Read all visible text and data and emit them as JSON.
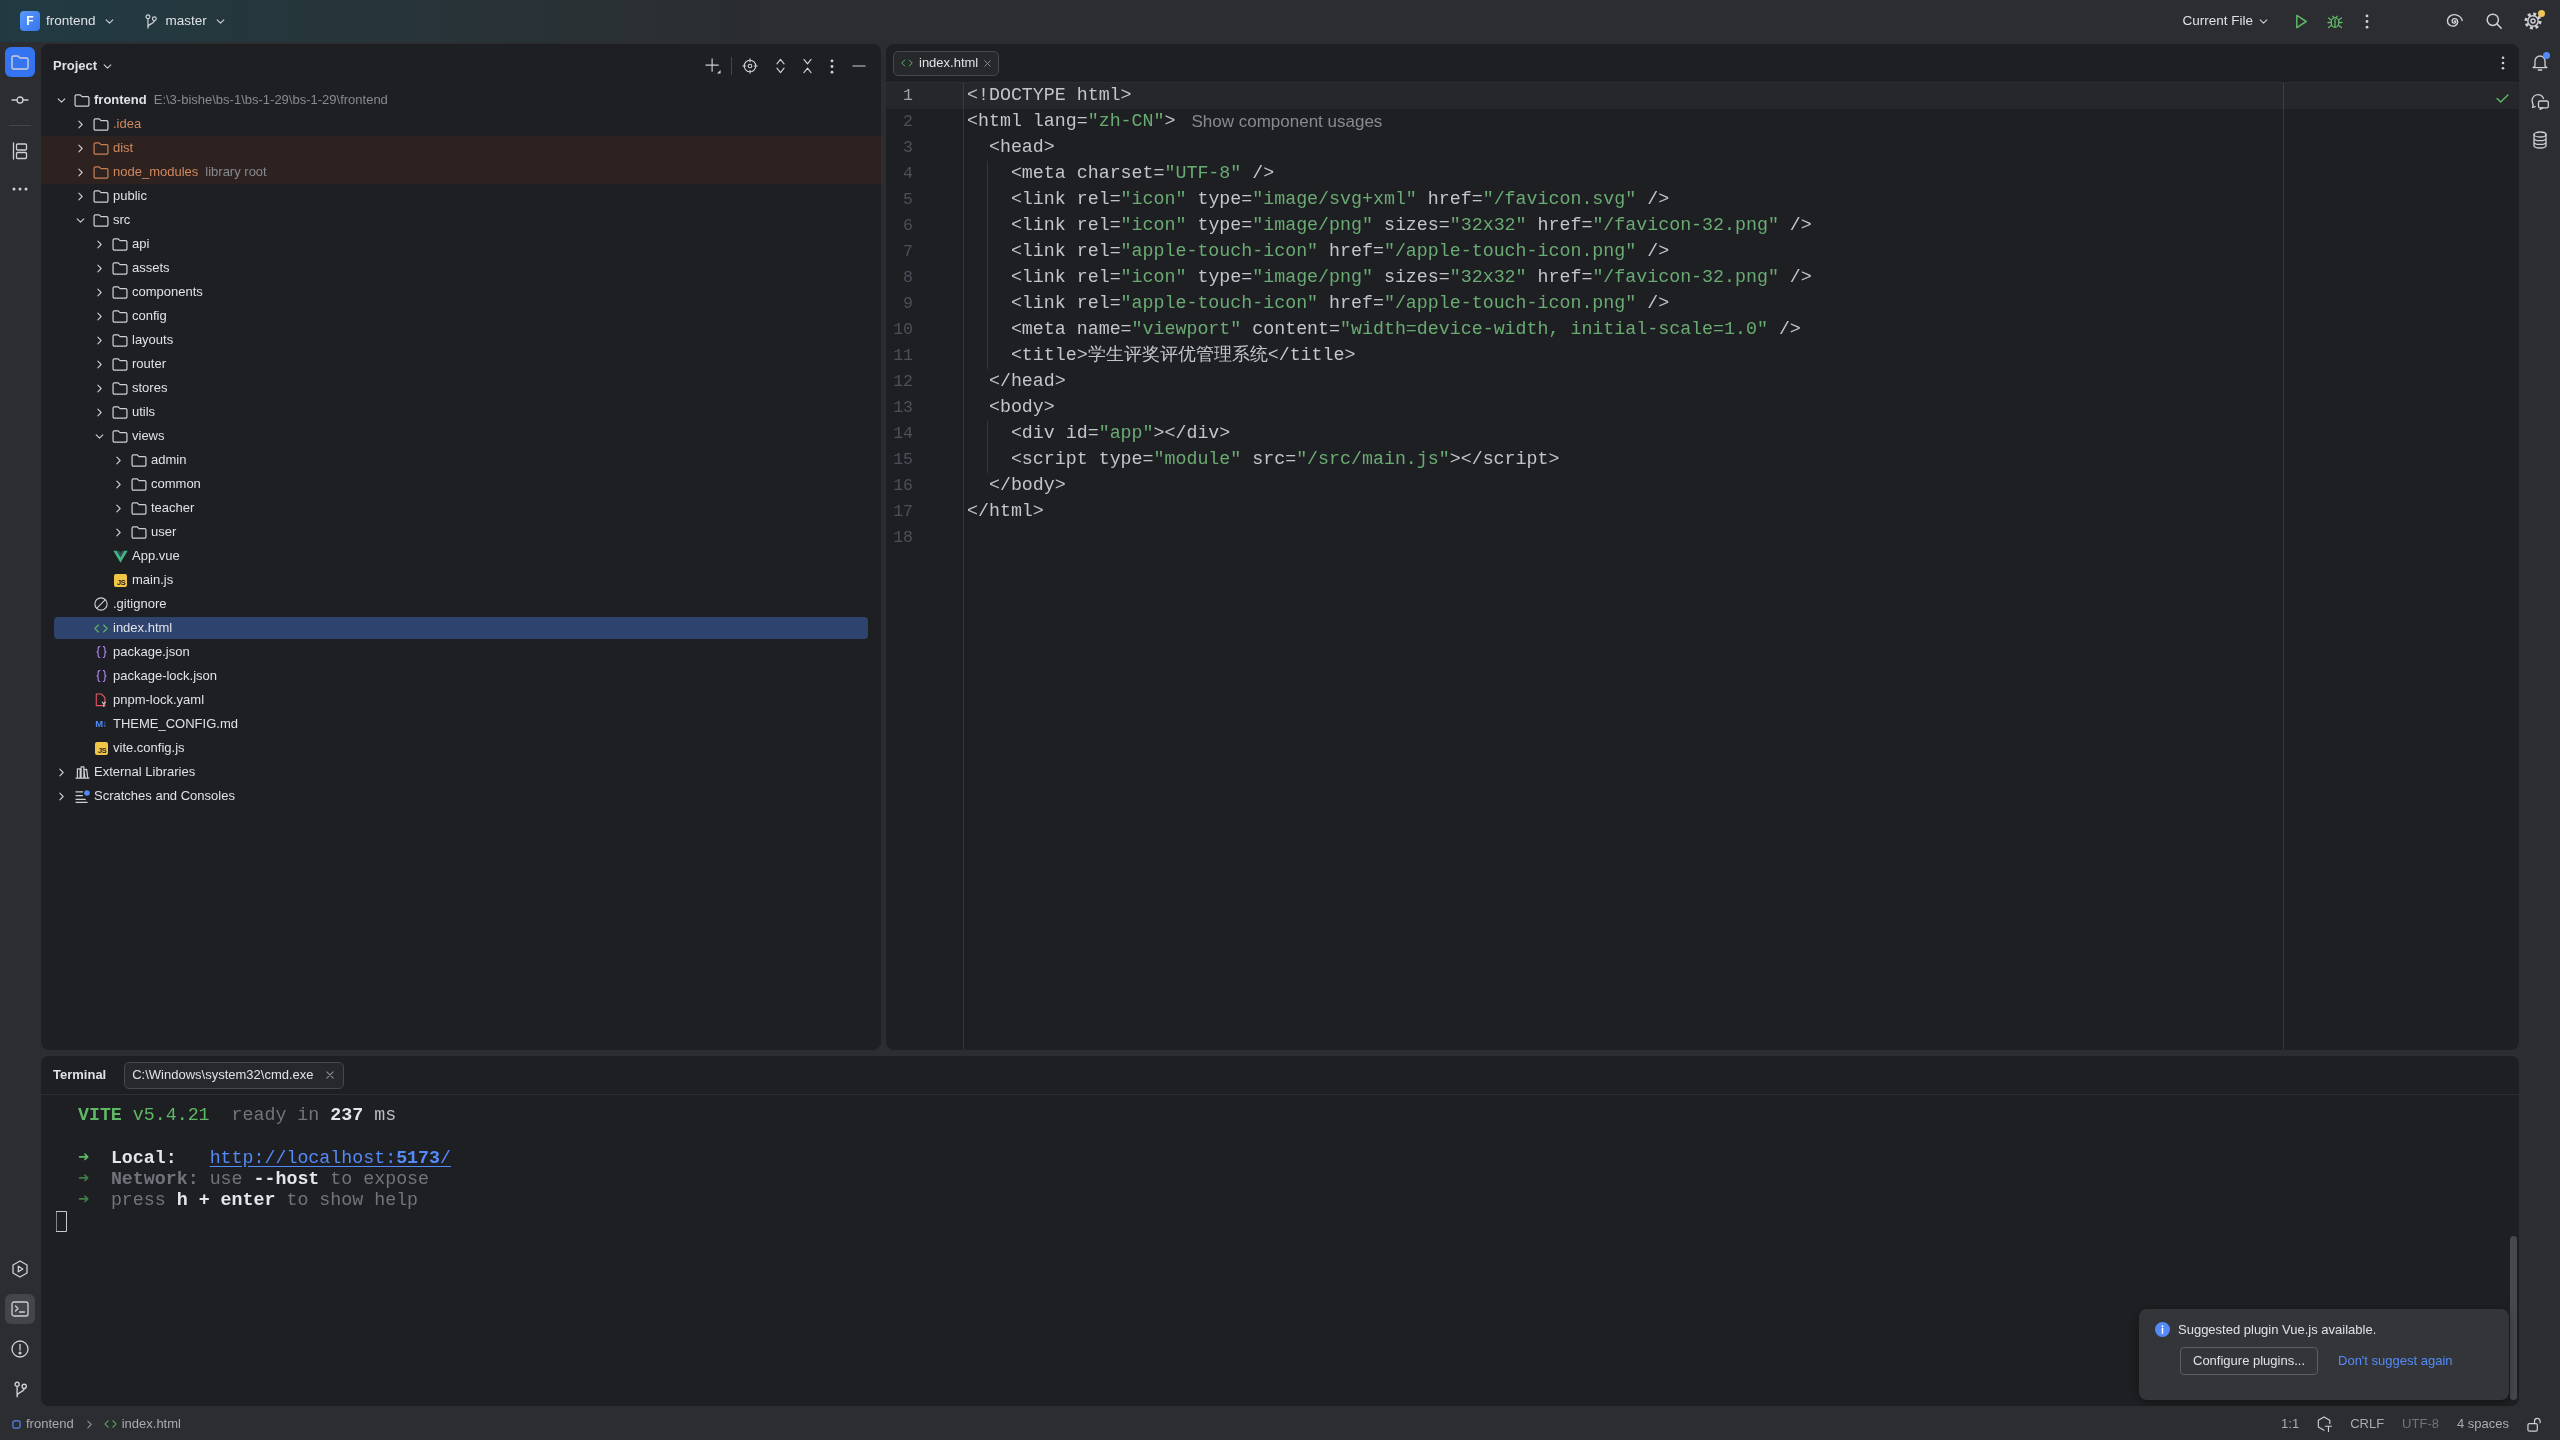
{
  "title_bar": {
    "project": {
      "initial": "F",
      "name": "frontend"
    },
    "branch": "master",
    "run_configuration": "Current File",
    "settings_update": true
  },
  "left_toolbar": {
    "top": [
      {
        "kind": "project",
        "selected": true,
        "focused": true
      },
      {
        "kind": "commit",
        "selected": false,
        "focused": false
      },
      {
        "kind": "structure",
        "selected": false,
        "focused": false
      },
      {
        "kind": "more",
        "selected": false,
        "focused": false
      }
    ],
    "bottom": [
      {
        "kind": "run",
        "selected": false,
        "focused": false
      },
      {
        "kind": "terminal",
        "selected": true,
        "focused": false
      },
      {
        "kind": "problems",
        "selected": false,
        "focused": false
      },
      {
        "kind": "git",
        "selected": false,
        "focused": false
      }
    ]
  },
  "right_toolbar": [
    {
      "kind": "notifications",
      "unread": true
    },
    {
      "kind": "ai_chat",
      "unread": false
    },
    {
      "kind": "database",
      "unread": false
    }
  ],
  "project_panel": {
    "title": "Project",
    "tree": [
      {
        "label": "frontend",
        "kind": "project",
        "hint": "E:\\3-bishe\\bs-1\\bs-1-29\\bs-1-29\\frontend",
        "expanded": true,
        "selected": false,
        "ignored": false,
        "excluded": false,
        "children": [
          {
            "label": ".idea",
            "kind": "folder",
            "expanded": false,
            "selected": false,
            "ignored": true,
            "excluded": false
          },
          {
            "label": "dist",
            "kind": "folder",
            "expanded": false,
            "selected": false,
            "ignored": true,
            "excluded": true
          },
          {
            "label": "node_modules",
            "kind": "folder",
            "hint": "library root",
            "expanded": false,
            "selected": false,
            "ignored": true,
            "excluded": true
          },
          {
            "label": "public",
            "kind": "folder",
            "expanded": false,
            "selected": false,
            "ignored": false,
            "excluded": false
          },
          {
            "label": "src",
            "kind": "folder",
            "expanded": true,
            "selected": false,
            "ignored": false,
            "excluded": false,
            "children": [
              {
                "label": "api",
                "kind": "folder",
                "expanded": false,
                "selected": false,
                "ignored": false,
                "excluded": false
              },
              {
                "label": "assets",
                "kind": "folder",
                "expanded": false,
                "selected": false,
                "ignored": false,
                "excluded": false
              },
              {
                "label": "components",
                "kind": "folder",
                "expanded": false,
                "selected": false,
                "ignored": false,
                "excluded": false
              },
              {
                "label": "config",
                "kind": "folder",
                "expanded": false,
                "selected": false,
                "ignored": false,
                "excluded": false
              },
              {
                "label": "layouts",
                "kind": "folder",
                "expanded": false,
                "selected": false,
                "ignored": false,
                "excluded": false
              },
              {
                "label": "router",
                "kind": "folder",
                "expanded": false,
                "selected": false,
                "ignored": false,
                "excluded": false
              },
              {
                "label": "stores",
                "kind": "folder",
                "expanded": false,
                "selected": false,
                "ignored": false,
                "excluded": false
              },
              {
                "label": "utils",
                "kind": "folder",
                "expanded": false,
                "selected": false,
                "ignored": false,
                "excluded": false
              },
              {
                "label": "views",
                "kind": "folder",
                "expanded": true,
                "selected": false,
                "ignored": false,
                "excluded": false,
                "children": [
                  {
                    "label": "admin",
                    "kind": "folder",
                    "expanded": false,
                    "selected": false,
                    "ignored": false,
                    "excluded": false
                  },
                  {
                    "label": "common",
                    "kind": "folder",
                    "expanded": false,
                    "selected": false,
                    "ignored": false,
                    "excluded": false
                  },
                  {
                    "label": "teacher",
                    "kind": "folder",
                    "expanded": false,
                    "selected": false,
                    "ignored": false,
                    "excluded": false
                  },
                  {
                    "label": "user",
                    "kind": "folder",
                    "expanded": false,
                    "selected": false,
                    "ignored": false,
                    "excluded": false
                  }
                ]
              },
              {
                "label": "App.vue",
                "kind": "vue",
                "selected": false,
                "ignored": false,
                "excluded": false
              },
              {
                "label": "main.js",
                "kind": "js",
                "icon_label": "JS",
                "selected": false,
                "ignored": false,
                "excluded": false
              }
            ]
          },
          {
            "label": ".gitignore",
            "kind": "gitignore",
            "selected": false,
            "ignored": false,
            "excluded": false
          },
          {
            "label": "index.html",
            "kind": "html",
            "selected": true,
            "ignored": false,
            "excluded": false
          },
          {
            "label": "package.json",
            "kind": "json",
            "selected": false,
            "ignored": false,
            "excluded": false
          },
          {
            "label": "package-lock.json",
            "kind": "json",
            "selected": false,
            "ignored": false,
            "excluded": false
          },
          {
            "label": "pnpm-lock.yaml",
            "kind": "yaml",
            "selected": false,
            "ignored": false,
            "excluded": false
          },
          {
            "label": "THEME_CONFIG.md",
            "kind": "markdown",
            "icon_label": "M↓",
            "selected": false,
            "ignored": false,
            "excluded": false
          },
          {
            "label": "vite.config.js",
            "kind": "js",
            "icon_label": "JS",
            "selected": false,
            "ignored": false,
            "excluded": false
          }
        ]
      },
      {
        "label": "External Libraries",
        "kind": "library",
        "expanded": false,
        "selected": false,
        "ignored": false,
        "excluded": false
      },
      {
        "label": "Scratches and Consoles",
        "kind": "scratches",
        "expanded": false,
        "selected": false,
        "ignored": false,
        "excluded": false
      }
    ]
  },
  "editor": {
    "tabs": [
      {
        "label": "index.html",
        "kind": "html",
        "selected": true
      }
    ],
    "lines": [
      {
        "number": "1",
        "current": true,
        "tokens": [
          {
            "kind": "markup",
            "text": "<!DOCTYPE html>"
          }
        ]
      },
      {
        "number": "2",
        "current": false,
        "tokens": [
          {
            "kind": "markup",
            "text": "<html lang="
          },
          {
            "kind": "string",
            "text": "\"zh-CN\""
          },
          {
            "kind": "markup",
            "text": ">"
          }
        ],
        "hint": "Show component usages"
      },
      {
        "number": "3",
        "current": false,
        "tokens": [
          {
            "kind": "markup",
            "text": "  <head>"
          }
        ]
      },
      {
        "number": "4",
        "current": false,
        "tokens": [
          {
            "kind": "markup",
            "text": "    <meta charset="
          },
          {
            "kind": "string",
            "text": "\"UTF-8\""
          },
          {
            "kind": "markup",
            "text": " />"
          }
        ]
      },
      {
        "number": "5",
        "current": false,
        "tokens": [
          {
            "kind": "markup",
            "text": "    <link rel="
          },
          {
            "kind": "string",
            "text": "\"icon\""
          },
          {
            "kind": "markup",
            "text": " type="
          },
          {
            "kind": "string",
            "text": "\"image/svg+xml\""
          },
          {
            "kind": "markup",
            "text": " href="
          },
          {
            "kind": "string",
            "text": "\"/favicon.svg\""
          },
          {
            "kind": "markup",
            "text": " />"
          }
        ]
      },
      {
        "number": "6",
        "current": false,
        "tokens": [
          {
            "kind": "markup",
            "text": "    <link rel="
          },
          {
            "kind": "string",
            "text": "\"icon\""
          },
          {
            "kind": "markup",
            "text": " type="
          },
          {
            "kind": "string",
            "text": "\"image/png\""
          },
          {
            "kind": "markup",
            "text": " sizes="
          },
          {
            "kind": "string",
            "text": "\"32x32\""
          },
          {
            "kind": "markup",
            "text": " href="
          },
          {
            "kind": "string",
            "text": "\"/favicon-32.png\""
          },
          {
            "kind": "markup",
            "text": " />"
          }
        ]
      },
      {
        "number": "7",
        "current": false,
        "tokens": [
          {
            "kind": "markup",
            "text": "    <link rel="
          },
          {
            "kind": "string",
            "text": "\"apple-touch-icon\""
          },
          {
            "kind": "markup",
            "text": " href="
          },
          {
            "kind": "string",
            "text": "\"/apple-touch-icon.png\""
          },
          {
            "kind": "markup",
            "text": " />"
          }
        ]
      },
      {
        "number": "8",
        "current": false,
        "tokens": [
          {
            "kind": "markup",
            "text": "    <link rel="
          },
          {
            "kind": "string",
            "text": "\"icon\""
          },
          {
            "kind": "markup",
            "text": " type="
          },
          {
            "kind": "string",
            "text": "\"image/png\""
          },
          {
            "kind": "markup",
            "text": " sizes="
          },
          {
            "kind": "string",
            "text": "\"32x32\""
          },
          {
            "kind": "markup",
            "text": " href="
          },
          {
            "kind": "string",
            "text": "\"/favicon-32.png\""
          },
          {
            "kind": "markup",
            "text": " />"
          }
        ]
      },
      {
        "number": "9",
        "current": false,
        "tokens": [
          {
            "kind": "markup",
            "text": "    <link rel="
          },
          {
            "kind": "string",
            "text": "\"apple-touch-icon\""
          },
          {
            "kind": "markup",
            "text": " href="
          },
          {
            "kind": "string",
            "text": "\"/apple-touch-icon.png\""
          },
          {
            "kind": "markup",
            "text": " />"
          }
        ]
      },
      {
        "number": "10",
        "current": false,
        "tokens": [
          {
            "kind": "markup",
            "text": "    <meta name="
          },
          {
            "kind": "string",
            "text": "\"viewport\""
          },
          {
            "kind": "markup",
            "text": " content="
          },
          {
            "kind": "string",
            "text": "\"width=device-width, initial-scale=1.0\""
          },
          {
            "kind": "markup",
            "text": " />"
          }
        ]
      },
      {
        "number": "11",
        "current": false,
        "tokens": [
          {
            "kind": "markup",
            "text": "    <title>"
          },
          {
            "kind": "text",
            "text": "学生评奖评优管理系统"
          },
          {
            "kind": "markup",
            "text": "</title>"
          }
        ]
      },
      {
        "number": "12",
        "current": false,
        "tokens": [
          {
            "kind": "markup",
            "text": "  </head>"
          }
        ]
      },
      {
        "number": "13",
        "current": false,
        "tokens": [
          {
            "kind": "markup",
            "text": "  <body>"
          }
        ]
      },
      {
        "number": "14",
        "current": false,
        "tokens": [
          {
            "kind": "markup",
            "text": "    <div id="
          },
          {
            "kind": "string",
            "text": "\"app\""
          },
          {
            "kind": "markup",
            "text": "></div>"
          }
        ]
      },
      {
        "number": "15",
        "current": false,
        "tokens": [
          {
            "kind": "markup",
            "text": "    <script type="
          },
          {
            "kind": "string",
            "text": "\"module\""
          },
          {
            "kind": "markup",
            "text": " src="
          },
          {
            "kind": "string",
            "text": "\"/src/main.js\""
          },
          {
            "kind": "markup",
            "text": "></script>"
          }
        ]
      },
      {
        "number": "16",
        "current": false,
        "tokens": [
          {
            "kind": "markup",
            "text": "  </body>"
          }
        ]
      },
      {
        "number": "17",
        "current": false,
        "tokens": [
          {
            "kind": "markup",
            "text": "</html>"
          }
        ]
      },
      {
        "number": "18",
        "current": false
      }
    ]
  },
  "terminal": {
    "title": "Terminal",
    "tabs": [
      {
        "label": "C:\\Windows\\system32\\cmd.exe",
        "selected": true
      }
    ],
    "lines": [
      {
        "kind": "banner",
        "tokens": [
          {
            "kind": "brand",
            "text": "VITE"
          },
          {
            "kind": "version",
            "text": "v5.4.21"
          },
          {
            "kind": "dim",
            "text": "ready in"
          },
          {
            "kind": "strong",
            "text": "237"
          },
          {
            "kind": "plain",
            "text": "ms"
          }
        ]
      },
      {
        "kind": "info",
        "tokens": [
          {
            "kind": "arrow",
            "text": "➜"
          },
          {
            "kind": "label",
            "text": "Local:"
          },
          {
            "kind": "link",
            "text": "http://localhost:**5173**/"
          }
        ]
      },
      {
        "kind": "info",
        "tokens": [
          {
            "kind": "arrow-dim",
            "text": "➜"
          },
          {
            "kind": "label-dim",
            "text": "Network:"
          },
          {
            "kind": "dim",
            "text": "use"
          },
          {
            "kind": "strong",
            "text": "--host"
          },
          {
            "kind": "dim",
            "text": "to expose"
          }
        ]
      },
      {
        "kind": "info",
        "tokens": [
          {
            "kind": "arrow-dim",
            "text": "➜"
          },
          {
            "kind": "dim",
            "text": "press"
          },
          {
            "kind": "strong",
            "text": "h + enter"
          },
          {
            "kind": "dim",
            "text": "to show help"
          }
        ]
      }
    ]
  },
  "notification": {
    "message": "Suggested plugin Vue.js available.",
    "actions": [
      {
        "kind": "button",
        "label": "Configure plugins..."
      },
      {
        "kind": "link",
        "label": "Don't suggest again"
      }
    ]
  },
  "status_bar": {
    "breadcrumbs": [
      {
        "kind": "module",
        "label": "frontend"
      },
      {
        "kind": "html",
        "label": "index.html"
      }
    ],
    "widgets": [
      {
        "kind": "position",
        "label": "1:1",
        "disabled": false
      },
      {
        "kind": "ai",
        "disabled": false
      },
      {
        "kind": "line_separator",
        "label": "CRLF",
        "disabled": false
      },
      {
        "kind": "encoding",
        "label": "UTF-8",
        "disabled": true
      },
      {
        "kind": "indent",
        "label": "4 spaces",
        "disabled": false
      },
      {
        "kind": "readonly",
        "disabled": false
      }
    ]
  }
}
